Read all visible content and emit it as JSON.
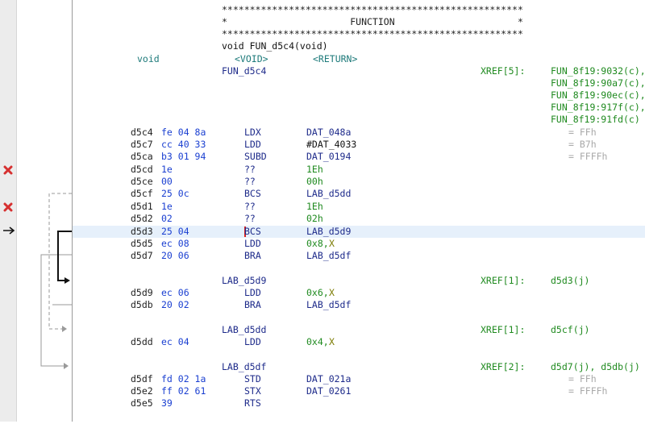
{
  "header": {
    "stars_line": "******************************************************",
    "function_banner": "*                      FUNCTION                      *",
    "signature": "void FUN_d5c4(void)",
    "return_type": "void",
    "void_label": "<VOID>",
    "return_label": "<RETURN>",
    "function_label": "FUN_d5c4",
    "xref_label": "XREF[5]:",
    "xrefs": [
      "FUN_8f19:9032(c),",
      "FUN_8f19:90a7(c),",
      "FUN_8f19:90ec(c),",
      "FUN_8f19:917f(c),",
      "FUN_8f19:91fd(c)"
    ]
  },
  "code": [
    {
      "addr": "d5c4",
      "bytes": "fe 04 8a",
      "mnemonic": "LDX",
      "operand": "DAT_048a",
      "extra": "",
      "comment": "= FFh"
    },
    {
      "addr": "d5c7",
      "bytes": "cc 40 33",
      "mnemonic": "LDD",
      "operand": "#DAT_4033",
      "extra": "",
      "comment": "= B7h"
    },
    {
      "addr": "d5ca",
      "bytes": "b3 01 94",
      "mnemonic": "SUBD",
      "operand": "DAT_0194",
      "extra": "",
      "comment": "= FFFFh"
    },
    {
      "addr": "d5cd",
      "bytes": "1e",
      "mnemonic": "??",
      "operand": "1Eh",
      "extra": "",
      "comment": ""
    },
    {
      "addr": "d5ce",
      "bytes": "00",
      "mnemonic": "??",
      "operand": "00h",
      "extra": "",
      "comment": ""
    },
    {
      "addr": "d5cf",
      "bytes": "25 0c",
      "mnemonic": "BCS",
      "operand": "LAB_d5dd",
      "extra": "",
      "comment": ""
    },
    {
      "addr": "d5d1",
      "bytes": "1e",
      "mnemonic": "??",
      "operand": "1Eh",
      "extra": "",
      "comment": ""
    },
    {
      "addr": "d5d2",
      "bytes": "02",
      "mnemonic": "??",
      "operand": "02h",
      "extra": "",
      "comment": ""
    },
    {
      "addr": "d5d3",
      "bytes": "25 04",
      "mnemonic": "BCS",
      "operand": "LAB_d5d9",
      "extra": "",
      "comment": ""
    },
    {
      "addr": "d5d5",
      "bytes": "ec 08",
      "mnemonic": "LDD",
      "operand": "0x8,",
      "extra": "X",
      "comment": ""
    },
    {
      "addr": "d5d7",
      "bytes": "20 06",
      "mnemonic": "BRA",
      "operand": "LAB_d5df",
      "extra": "",
      "comment": ""
    }
  ],
  "labels": [
    {
      "name": "LAB_d5d9",
      "xref_label": "XREF[1]:",
      "xref": "d5d3(j)",
      "code": [
        {
          "addr": "d5d9",
          "bytes": "ec 06",
          "mnemonic": "LDD",
          "operand": "0x6,",
          "extra": "X",
          "comment": ""
        },
        {
          "addr": "d5db",
          "bytes": "20 02",
          "mnemonic": "BRA",
          "operand": "LAB_d5df",
          "extra": "",
          "comment": ""
        }
      ]
    },
    {
      "name": "LAB_d5dd",
      "xref_label": "XREF[1]:",
      "xref": "d5cf(j)",
      "code": [
        {
          "addr": "d5dd",
          "bytes": "ec 04",
          "mnemonic": "LDD",
          "operand": "0x4,",
          "extra": "X",
          "comment": ""
        }
      ]
    },
    {
      "name": "LAB_d5df",
      "xref_label": "XREF[2]:",
      "xref": "d5d7(j), d5db(j)",
      "code": [
        {
          "addr": "d5df",
          "bytes": "fd 02 1a",
          "mnemonic": "STD",
          "operand": "DAT_021a",
          "extra": "",
          "comment": "= FFh"
        },
        {
          "addr": "d5e2",
          "bytes": "ff 02 61",
          "mnemonic": "STX",
          "operand": "DAT_0261",
          "extra": "",
          "comment": "= FFFFh"
        },
        {
          "addr": "d5e5",
          "bytes": "39",
          "mnemonic": "RTS",
          "operand": "",
          "extra": "",
          "comment": ""
        }
      ]
    }
  ],
  "colors": {
    "address": "#222222",
    "bytes": "#1a3fd1",
    "mnemonic": "#1d2a8a",
    "label": "#1d2a8a",
    "type": "#1d7a7a",
    "xref": "#1f8a1f",
    "register": "#7a7a00",
    "comment": "#a9a9a9",
    "cursor_row": "#e6f0fb",
    "error_mark": "#d63030"
  },
  "icons": {
    "error": "x-error-icon",
    "cursor": "arrow-right-icon"
  }
}
